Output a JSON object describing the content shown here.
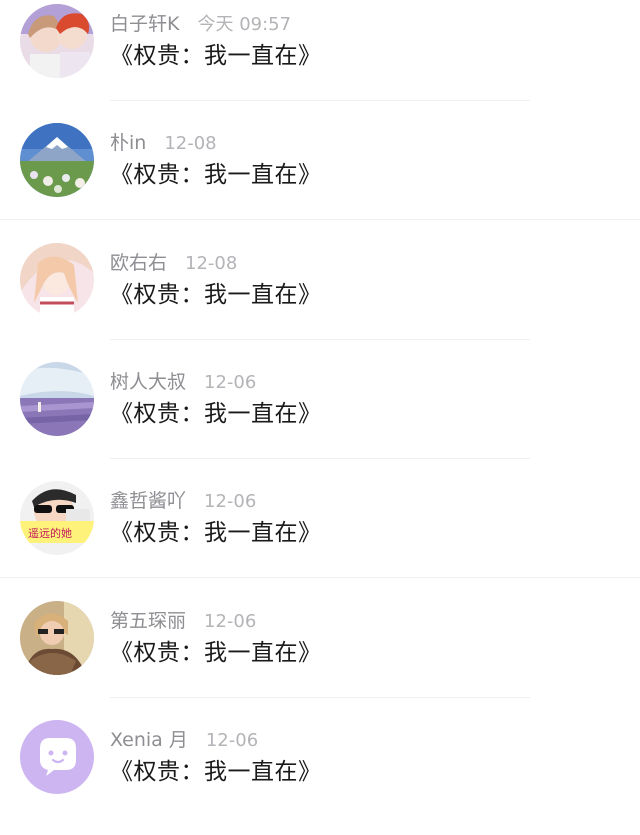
{
  "comments": [
    {
      "name": "白子轩K",
      "time": "今天 09:57",
      "text": "《权贵：我一直在》",
      "avatar": "avatar-two-people-icon"
    },
    {
      "name": "朴in",
      "time": "12-08",
      "text": "《权贵：我一直在》",
      "avatar": "avatar-mountain-icon"
    },
    {
      "name": "欧右右",
      "time": "12-08",
      "text": "《权贵：我一直在》",
      "avatar": "avatar-anime-girl-icon"
    },
    {
      "name": "树人大叔",
      "time": "12-06",
      "text": "《权贵：我一直在》",
      "avatar": "avatar-lavender-field-icon"
    },
    {
      "name": "鑫哲酱吖",
      "time": "12-06",
      "text": "《权贵：我一直在》",
      "avatar": "avatar-sunglasses-person-icon",
      "avatar_caption": "遥远的她"
    },
    {
      "name": "第五琛丽",
      "time": "12-06",
      "text": "《权贵：我一直在》",
      "avatar": "avatar-fur-coat-person-icon"
    },
    {
      "name": "Xenia 月",
      "time": "12-06",
      "text": "《权贵：我一直在》",
      "avatar": "avatar-default-chat-icon"
    }
  ],
  "colors": {
    "name": "#8e8e93",
    "time": "#b4b4b8",
    "text": "#1a1a1a",
    "divider": "#efeff2",
    "default_avatar": "#cdb5f2"
  }
}
